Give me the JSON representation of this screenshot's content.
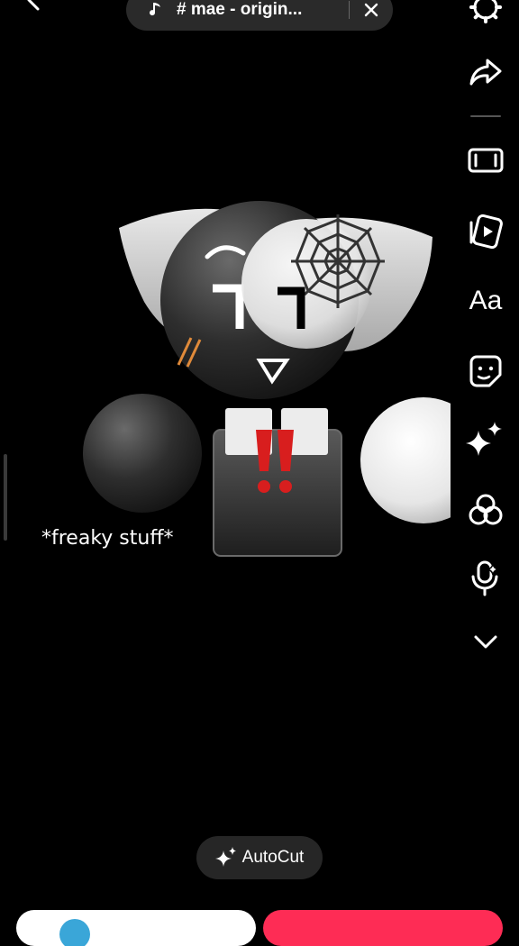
{
  "music": {
    "title": "# mae - origin..."
  },
  "toolbar": {
    "text_tool_label": "Aa"
  },
  "caption": {
    "text": "*freaky stuff*"
  },
  "autocut": {
    "label": "AutoCut"
  },
  "icons": {
    "back": "chevron-left-icon",
    "note": "music-note-icon",
    "close": "close-icon",
    "settings": "gear-icon",
    "share": "share-arrow-icon",
    "aspect": "aspect-ratio-icon",
    "templates": "video-card-icon",
    "sticker": "sticker-icon",
    "effects": "sparkle-icon",
    "filters": "filter-circles-icon",
    "voice": "voice-effect-mic-icon",
    "more": "chevron-down-icon",
    "autocut": "sparkle-icon"
  },
  "colors": {
    "accent": "#fe2c55",
    "exclaim": "#d81e1e",
    "slash": "#e08a3a"
  }
}
